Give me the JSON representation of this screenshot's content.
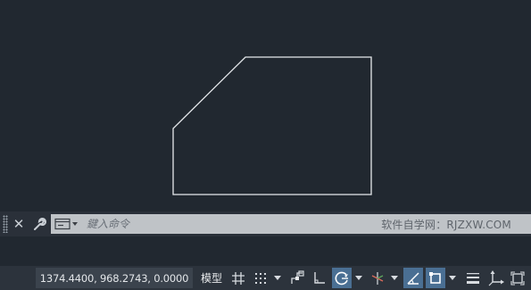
{
  "command_line": {
    "placeholder": "鍵入命令",
    "watermark": "软件自学网：RJZXW.COM"
  },
  "status_bar": {
    "coordinates": "1374.4400, 968.2743, 0.0000",
    "model_label": "模型",
    "toggles": {
      "grid": false,
      "snap": false,
      "infer_constraints": false,
      "ortho": false,
      "polar": true,
      "isodraft": false,
      "object_snap_tracking": false,
      "object_snap": true,
      "show_lineweight": false
    }
  },
  "colors": {
    "canvas": "#212830",
    "drawing_line": "#e6e9ec",
    "command_bar": "#2a3039",
    "command_input": "#bfc3c7",
    "status_bar": "#2c333c",
    "active_toggle": "#4a6f93"
  },
  "icons": [
    "grip-icon",
    "close-icon",
    "wrench-icon",
    "command-prompt-icon",
    "grid-icon",
    "snap-icon",
    "infer-icon",
    "ortho-icon",
    "polar-icon",
    "isodraft-icon",
    "tracking-icon",
    "object-snap-icon",
    "lineweight-icon",
    "ucs-icon",
    "viewport-icon"
  ]
}
